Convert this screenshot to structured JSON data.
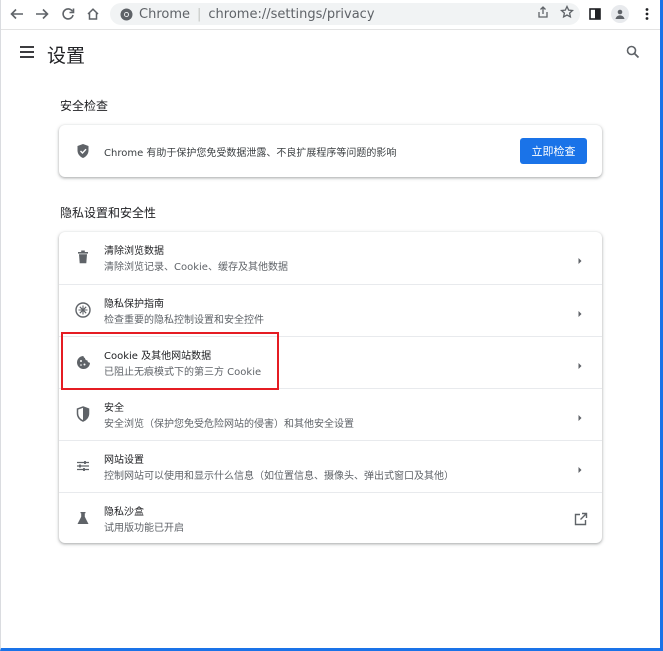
{
  "browser": {
    "omnibox": {
      "origin": "Chrome",
      "separator": "|",
      "url": "chrome://settings/privacy"
    },
    "icons": [
      "back-icon",
      "forward-icon",
      "reload-icon",
      "home-icon",
      "share-icon",
      "bookmark-star-icon",
      "side-panel-icon",
      "profile-icon",
      "more-menu-icon"
    ]
  },
  "header": {
    "title": "设置"
  },
  "safety_check": {
    "section_title": "安全检查",
    "description": "Chrome 有助于保护您免受数据泄露、不良扩展程序等问题的影响",
    "button_label": "立即检查"
  },
  "privacy": {
    "section_title": "隐私设置和安全性",
    "items": [
      {
        "title": "清除浏览数据",
        "subtitle": "清除浏览记录、Cookie、缓存及其他数据",
        "icon": "trash-icon"
      },
      {
        "title": "隐私保护指南",
        "subtitle": "检查重要的隐私控制设置和安全控件",
        "icon": "privacy-guide-icon"
      },
      {
        "title": "Cookie 及其他网站数据",
        "subtitle": "已阻止无痕模式下的第三方 Cookie",
        "icon": "cookie-icon"
      },
      {
        "title": "安全",
        "subtitle": "安全浏览（保护您免受危险网站的侵害）和其他安全设置",
        "icon": "shield-icon"
      },
      {
        "title": "网站设置",
        "subtitle": "控制网站可以使用和显示什么信息（如位置信息、摄像头、弹出式窗口及其他）",
        "icon": "tune-icon"
      },
      {
        "title": "隐私沙盒",
        "subtitle": "试用版功能已开启",
        "icon": "flask-icon"
      }
    ]
  },
  "colors": {
    "accent": "#1a73e8",
    "highlight": "#e51c23"
  }
}
